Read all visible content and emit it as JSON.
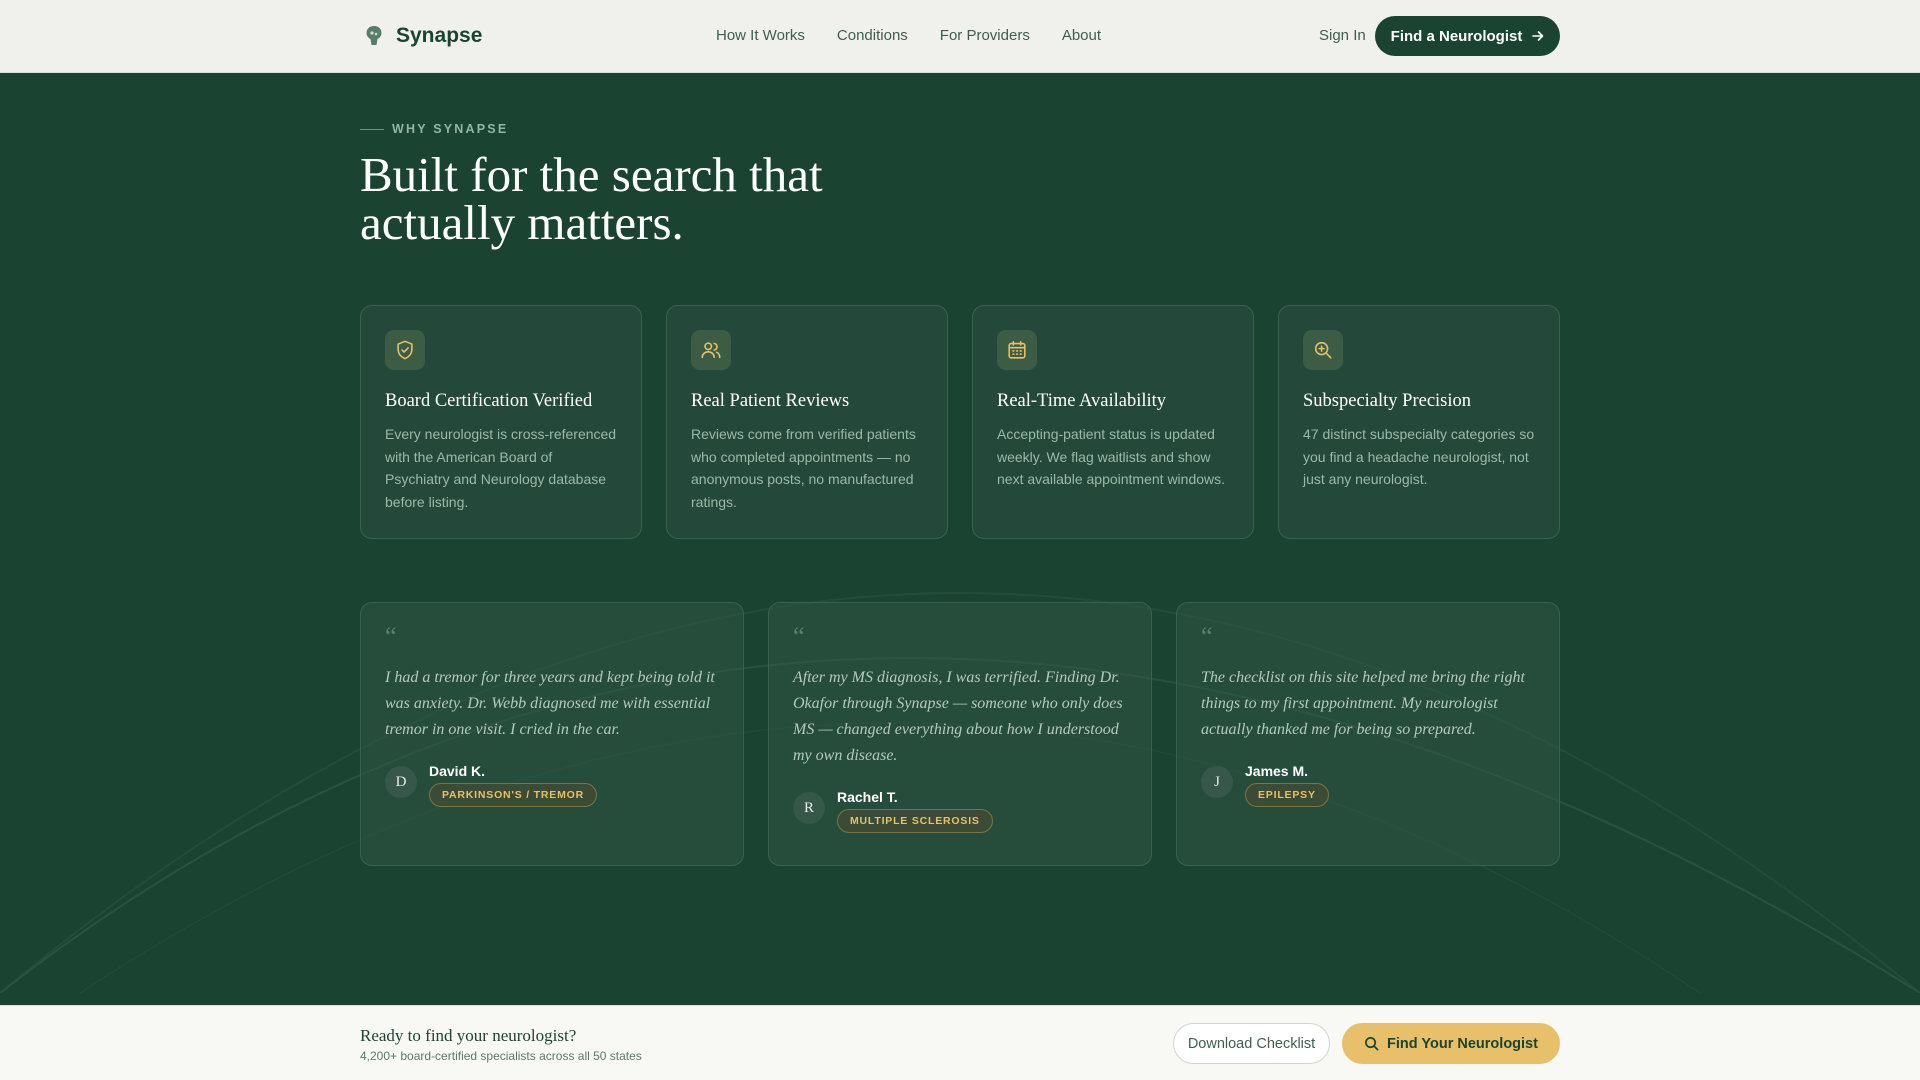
{
  "header": {
    "brand": "Synapse",
    "nav": [
      "How It Works",
      "Conditions",
      "For Providers",
      "About"
    ],
    "sign_in": "Sign In",
    "cta": "Find a Neurologist"
  },
  "section": {
    "eyebrow": "WHY SYNAPSE",
    "headline_line1": "Built for the search that",
    "headline_line2": "actually matters."
  },
  "features": [
    {
      "icon": "shield-check-icon",
      "title": "Board Certification Verified",
      "body": "Every neurologist is cross-referenced with the American Board of Psychiatry and Neurology database before listing."
    },
    {
      "icon": "users-icon",
      "title": "Real Patient Reviews",
      "body": "Reviews come from verified patients who completed appointments — no anonymous posts, no manufactured ratings."
    },
    {
      "icon": "calendar-icon",
      "title": "Real-Time Availability",
      "body": "Accepting-patient status is updated weekly. We flag waitlists and show next available appointment windows."
    },
    {
      "icon": "zoom-in-icon",
      "title": "Subspecialty Precision",
      "body": "47 distinct subspecialty categories so you find a headache neurologist, not just any neurologist."
    }
  ],
  "testimonials": [
    {
      "quote_mark": "“",
      "quote": "I had a tremor for three years and kept being told it was anxiety. Dr. Webb diagnosed me with essential tremor in one visit. I cried in the car.",
      "initial": "D",
      "name": "David K.",
      "badge": "PARKINSON'S / TREMOR"
    },
    {
      "quote_mark": "“",
      "quote": "After my MS diagnosis, I was terrified. Finding Dr. Okafor through Synapse — someone who only does MS — changed everything about how I understood my own disease.",
      "initial": "R",
      "name": "Rachel T.",
      "badge": "MULTIPLE SCLEROSIS"
    },
    {
      "quote_mark": "“",
      "quote": "The checklist on this site helped me bring the right things to my first appointment. My neurologist actually thanked me for being so prepared.",
      "initial": "J",
      "name": "James M.",
      "badge": "EPILEPSY"
    }
  ],
  "cta_bar": {
    "title": "Ready to find your neurologist?",
    "subtitle": "4,200+ board-certified specialists across all 50 states",
    "download": "Download Checklist",
    "find": "Find Your Neurologist"
  },
  "colors": {
    "primary": "#1b4332",
    "accent": "#e8c06a",
    "header_bg": "#f0f0ec"
  }
}
